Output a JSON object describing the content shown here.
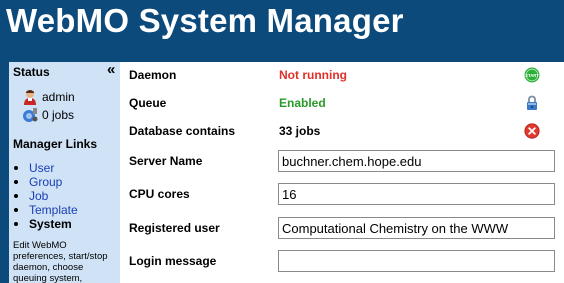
{
  "header": {
    "title": "WebMO System Manager"
  },
  "sidebar": {
    "status_heading": "Status",
    "user": "admin",
    "jobs": "0 jobs",
    "links_heading": "Manager Links",
    "links": [
      {
        "label": "User"
      },
      {
        "label": "Group"
      },
      {
        "label": "Job"
      },
      {
        "label": "Template"
      },
      {
        "label": "System"
      }
    ],
    "help_text": "Edit WebMO preferences, start/stop daemon, choose queuing system,"
  },
  "main": {
    "daemon": {
      "label": "Daemon",
      "value": "Not running",
      "color": "#e0302a",
      "icon": "start-icon"
    },
    "queue": {
      "label": "Queue",
      "value": "Enabled",
      "color": "#2a9a2a",
      "icon": "lock-icon"
    },
    "database": {
      "label": "Database contains",
      "value": "33 jobs",
      "icon": "delete-icon"
    },
    "server_name": {
      "label": "Server Name",
      "value": "buchner.chem.hope.edu"
    },
    "cpu_cores": {
      "label": "CPU cores",
      "value": "16"
    },
    "registered_user": {
      "label": "Registered user",
      "value": "Computational Chemistry on the WWW"
    },
    "login_message": {
      "label": "Login message",
      "value": ""
    }
  },
  "colors": {
    "header_bg": "#0d4a7c",
    "sidebar_bg": "#cfe2f6",
    "link": "#1a3fb3"
  }
}
